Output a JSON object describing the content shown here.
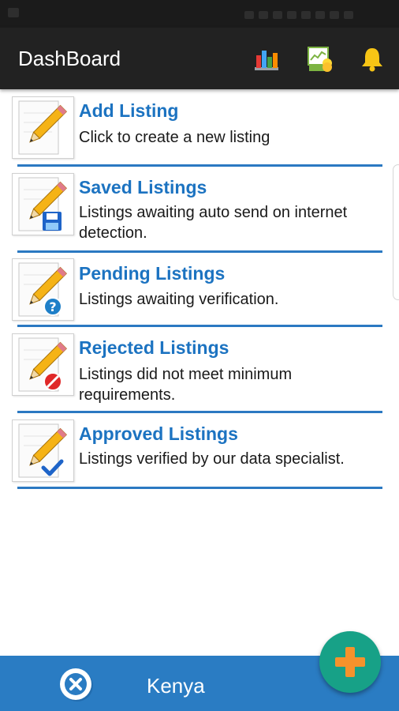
{
  "app_bar": {
    "title": "DashBoard",
    "icons": [
      "bar-chart-icon",
      "report-icon",
      "bell-icon"
    ]
  },
  "listings": [
    {
      "title": "Add Listing",
      "description": "Click to create a new listing",
      "icon": "pencil-icon"
    },
    {
      "title": "Saved Listings",
      "description": "Listings awaiting auto send on internet detection.",
      "icon": "pencil-save-icon"
    },
    {
      "title": "Pending Listings",
      "description": "Listings awaiting verification.",
      "icon": "pencil-question-icon"
    },
    {
      "title": "Rejected Listings",
      "description": "Listings did not meet minimum requirements.",
      "icon": "pencil-rejected-icon"
    },
    {
      "title": "Approved Listings",
      "description": "Listings verified by our data specialist.",
      "icon": "pencil-check-icon"
    }
  ],
  "bottom_bar": {
    "country": "Kenya",
    "close_icon": "close-icon",
    "fab_icon": "plus-icon"
  },
  "colors": {
    "app_bar": "#222222",
    "title_blue": "#1c73c1",
    "divider": "#2b79c2",
    "bottom_bar": "#2a7cc3",
    "fab": "#17a187",
    "fab_plus": "#f5922c",
    "bell": "#f7c515"
  }
}
